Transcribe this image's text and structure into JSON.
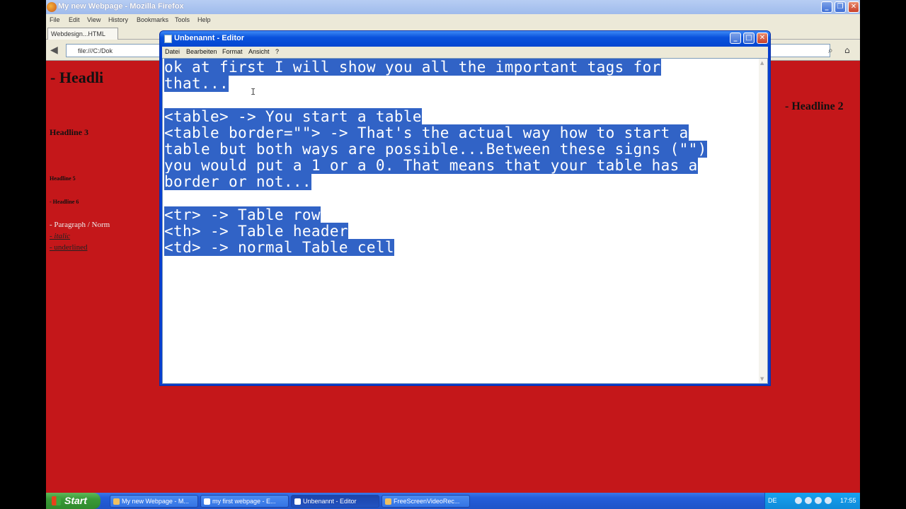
{
  "firefox": {
    "title": "My new Webpage - Mozilla Firefox",
    "menu": [
      "File",
      "Edit",
      "View",
      "History",
      "Bookmarks",
      "Tools",
      "Help"
    ],
    "tab_label": "Webdesign...HTML",
    "url": "file:///C:/Dok"
  },
  "page": {
    "h1": "- Headli",
    "h2": "- Headline 2",
    "h3": "Headline 3",
    "h5": "Headline 5",
    "h6": "- Headline 6",
    "paragraph": "- Paragraph / Norm",
    "italic": "- italic",
    "underlined": "- underlined",
    "background_color": "#c4171a"
  },
  "notepad": {
    "title": "Unbenannt - Editor",
    "menu": [
      "Datei",
      "Bearbeiten",
      "Format",
      "Ansicht",
      "?"
    ],
    "lines": [
      "ok at first I will show you all the important tags for",
      "that...",
      "",
      "<table> -> You start a table",
      "<table border=\"\"> -> That's the actual way how to start a",
      "table but both ways are possible...Between these signs (\"\")",
      "you would put a 1 or a 0. That means that your table has a",
      "border or not...",
      "",
      "<tr> -> Table row",
      "<th> -> Table header",
      "<td> -> normal Table cell"
    ],
    "selection_color": "#3163c6"
  },
  "taskbar": {
    "start_label": "Start",
    "tasks": [
      "My new Webpage - M...",
      "my first webpage - E...",
      "Unbenannt - Editor",
      "FreeScreenVideoRec..."
    ],
    "lang": "DE",
    "time": "17:55"
  }
}
